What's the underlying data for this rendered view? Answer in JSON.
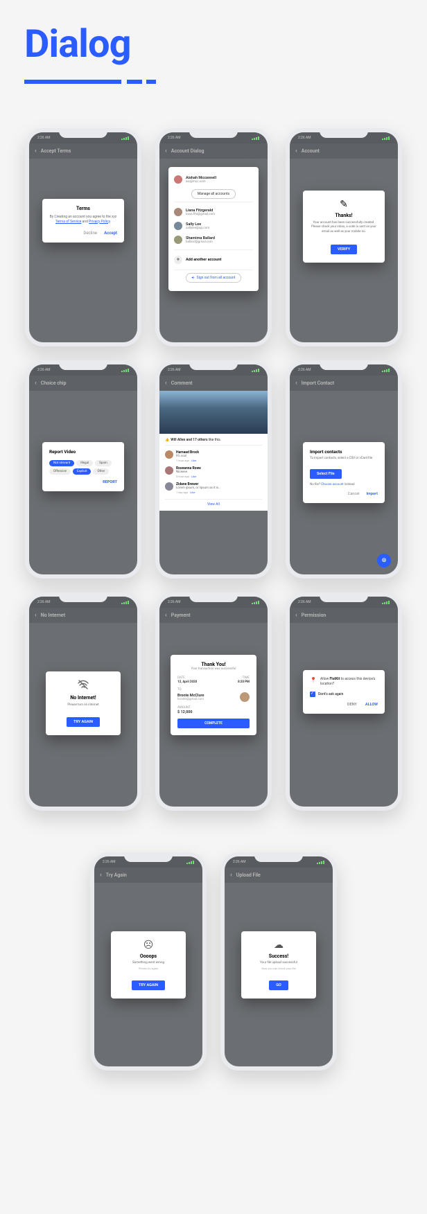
{
  "page_title": "Dialog",
  "status_time": "2:26 AM",
  "screens": {
    "accept_terms": {
      "topbar": "Accept Terms",
      "title": "Terms",
      "body_prefix": "By Creating an account you agree to the xyz ",
      "tos_link": "Terms of Service",
      "body_mid": " and ",
      "privacy_link": "Privacy Policy",
      "decline": "Decline",
      "accept": "Accept"
    },
    "account_dialog": {
      "topbar": "Account Dialog",
      "accounts": [
        {
          "name": "Aishah Mcconnell",
          "email": "ais@mcc.com"
        },
        {
          "name": "Liana Fitzgerald",
          "email": "liana.fits@gmail.com"
        },
        {
          "name": "Sally Lee",
          "email": "sallylee@qq.com"
        },
        {
          "name": "Shamima Ballard",
          "email": "ballard@gmail.com"
        }
      ],
      "manage": "Manage all accounts",
      "add": "Add another account",
      "signout": "Sign out from all account"
    },
    "account": {
      "topbar": "Account",
      "title": "Thanks!",
      "body": "Your account has been successfully created. Please check your inbox, a code is sent on your email as well as your mobile no.",
      "button": "VERIFY"
    },
    "choice_chip": {
      "topbar": "Choice chip",
      "title": "Report Video",
      "chips": [
        "Not relevant",
        "Illegal",
        "Spam",
        "Offensive",
        "Explicit",
        "Other"
      ],
      "report": "REPORT"
    },
    "comment": {
      "topbar": "Comment",
      "likes_name": "Will Allen",
      "likes_count": " and 17 others",
      "likes_suffix": " like this.",
      "comments": [
        {
          "name": "Hamaad Brock",
          "text": "It's cool",
          "meta": "1 hour ago",
          "like": "Like"
        },
        {
          "name": "Roseanna Rowe",
          "text": "Niceeee",
          "meta": "5 hour ago",
          "like": "Like"
        },
        {
          "name": "Zidane Brewer",
          "text": "Lorem ipsum, or lipsum as it is…",
          "meta": "1 day ago",
          "like": "Like"
        }
      ],
      "view_all": "View All"
    },
    "import_contact": {
      "topbar": "Import Contact",
      "title": "Import contacts",
      "body": "To import contacts, select a CSV or vCard file",
      "select": "Select File",
      "nofile_prefix": "No file? ",
      "nofile_link": "Choose account",
      "nofile_suffix": " instead",
      "cancel": "Cancel",
      "import": "Import"
    },
    "no_internet": {
      "topbar": "No Internet",
      "title": "No Internet!",
      "body": "Please turn on internet",
      "button": "TRY AGAIN"
    },
    "payment": {
      "topbar": "Payment",
      "title": "Thank You!",
      "sub": "Your transaction was successful",
      "date_label": "DATE",
      "date_val": "12, April 2020",
      "time_label": "TIME",
      "time_val": "8:20 PM",
      "to_label": "TO",
      "to_name": "Bronte McClure",
      "to_email": "bronte@gmail.com",
      "amount_label": "AMOUNT",
      "amount_val": "$ 12,000",
      "button": "COMPLETE"
    },
    "permission": {
      "topbar": "Permission",
      "body_prefix": "Allow ",
      "app_name": "FlutKit",
      "body_suffix": " to access this device's location?",
      "dont_ask": "Dont's ask again",
      "deny": "DENY",
      "allow": "ALLOW"
    },
    "try_again": {
      "topbar": "Try Again",
      "title": "Oooops",
      "body": "Something went wrong",
      "hint": "Please try again",
      "button": "TRY AGAIN"
    },
    "upload_file": {
      "topbar": "Upload File",
      "title": "Success!",
      "body": "Your file upload successful",
      "hint": "Now you can check your file",
      "button": "GO"
    }
  }
}
